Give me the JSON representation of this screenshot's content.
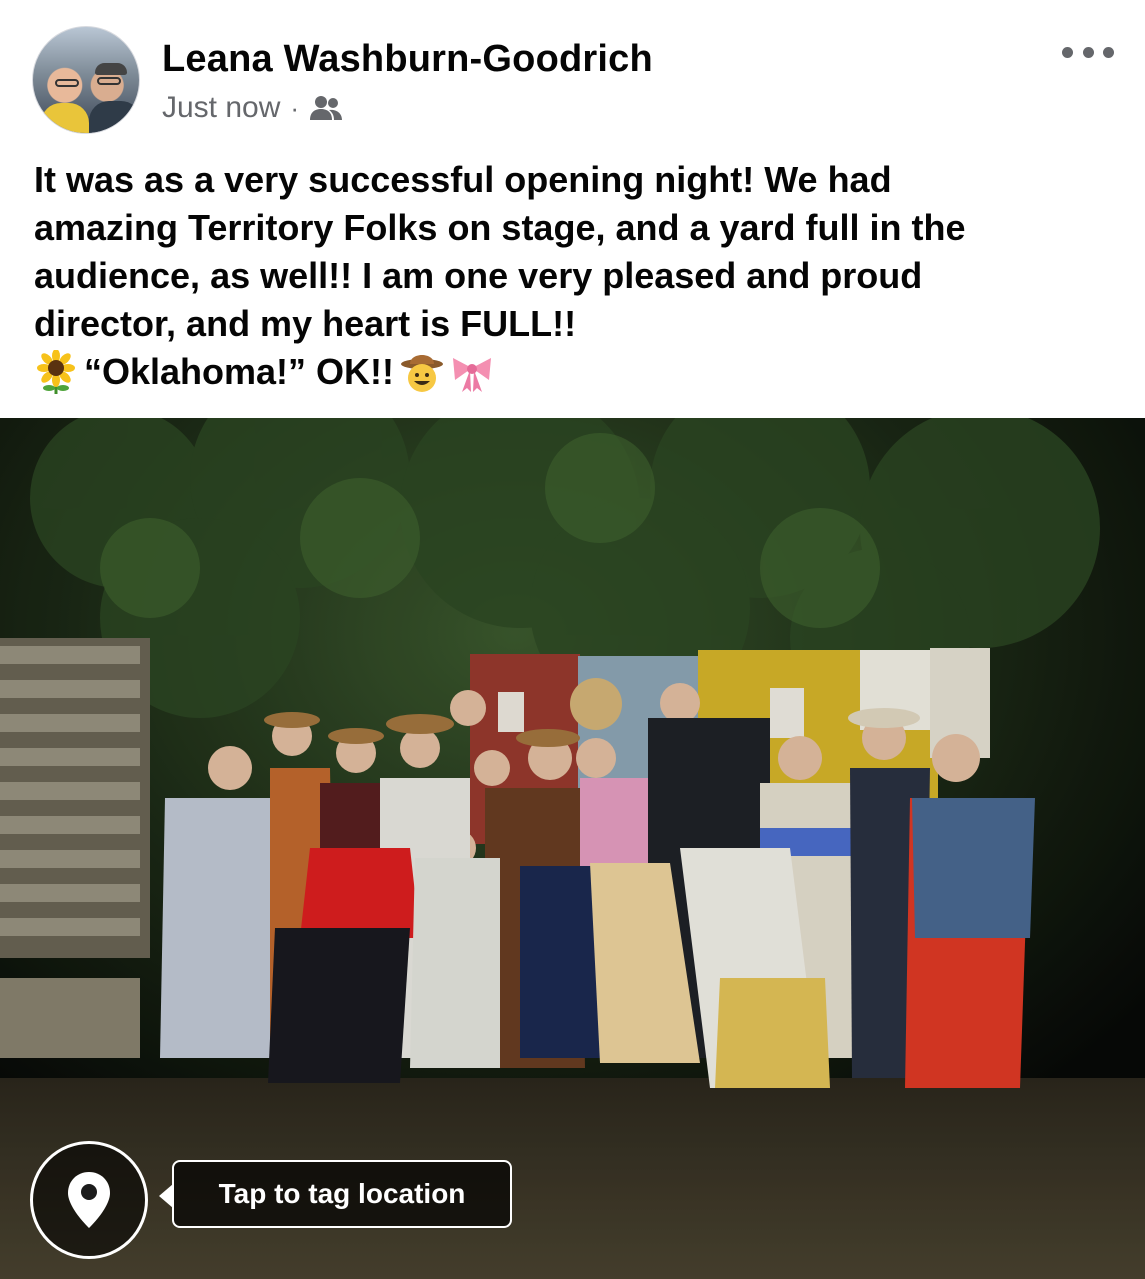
{
  "post": {
    "author": "Leana Washburn-Goodrich",
    "timestamp": "Just now",
    "separator": "·",
    "audience_icon": "friends-icon",
    "more_icon": "more-horizontal-icon",
    "text_lines": [
      "It was as a very successful opening night! We had",
      "amazing Territory Folks on stage, and a yard full in the",
      "audience, as well!! I am one very pleased and proud",
      "director, and my heart is FULL!!"
    ],
    "last_line_text": "“Oklahoma!” OK!!",
    "emojis": [
      "sunflower-emoji",
      "cowboy-face-emoji",
      "ribbon-emoji"
    ]
  },
  "photo": {
    "location_button_icon": "location-pin-icon",
    "tag_location_label": "Tap to tag location"
  },
  "colors": {
    "text_primary": "#050505",
    "text_secondary": "#65676b",
    "background": "#ffffff"
  }
}
